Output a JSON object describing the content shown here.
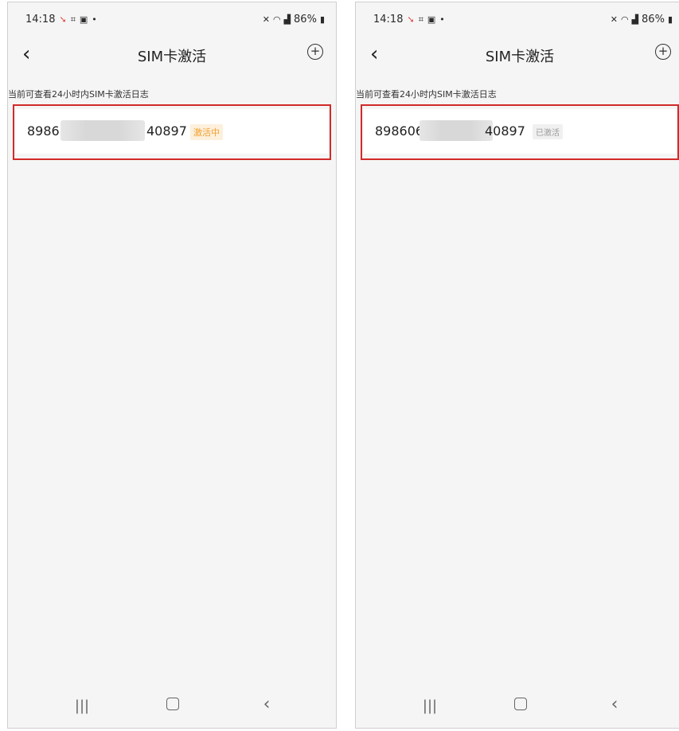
{
  "screens": [
    {
      "status_bar": {
        "time": "14:18",
        "battery": "86%"
      },
      "nav": {
        "title": "SIM卡激活"
      },
      "hint": "当前可查看24小时内SIM卡激活日志",
      "sim_entry": {
        "iccid_start": "8986",
        "iccid_end": "40897",
        "status": "激活中"
      }
    },
    {
      "status_bar": {
        "time": "14:18",
        "battery": "86%"
      },
      "nav": {
        "title": "SIM卡激活"
      },
      "hint": "当前可查看24小时内SIM卡激活日志",
      "sim_entry": {
        "iccid_start": "898606",
        "iccid_end": "40897",
        "status": "已激活"
      }
    }
  ],
  "icons": {
    "back": "chevron-left-icon",
    "add": "plus-circle-icon",
    "recents": "recents-icon",
    "home": "home-icon",
    "nav_back": "back-arrow-icon"
  },
  "colors": {
    "highlight_border": "#d32a2a",
    "activating_badge_bg": "#fdf0dc",
    "activating_badge_text": "#f0a030",
    "activated_badge_text": "#9a9a9a"
  }
}
